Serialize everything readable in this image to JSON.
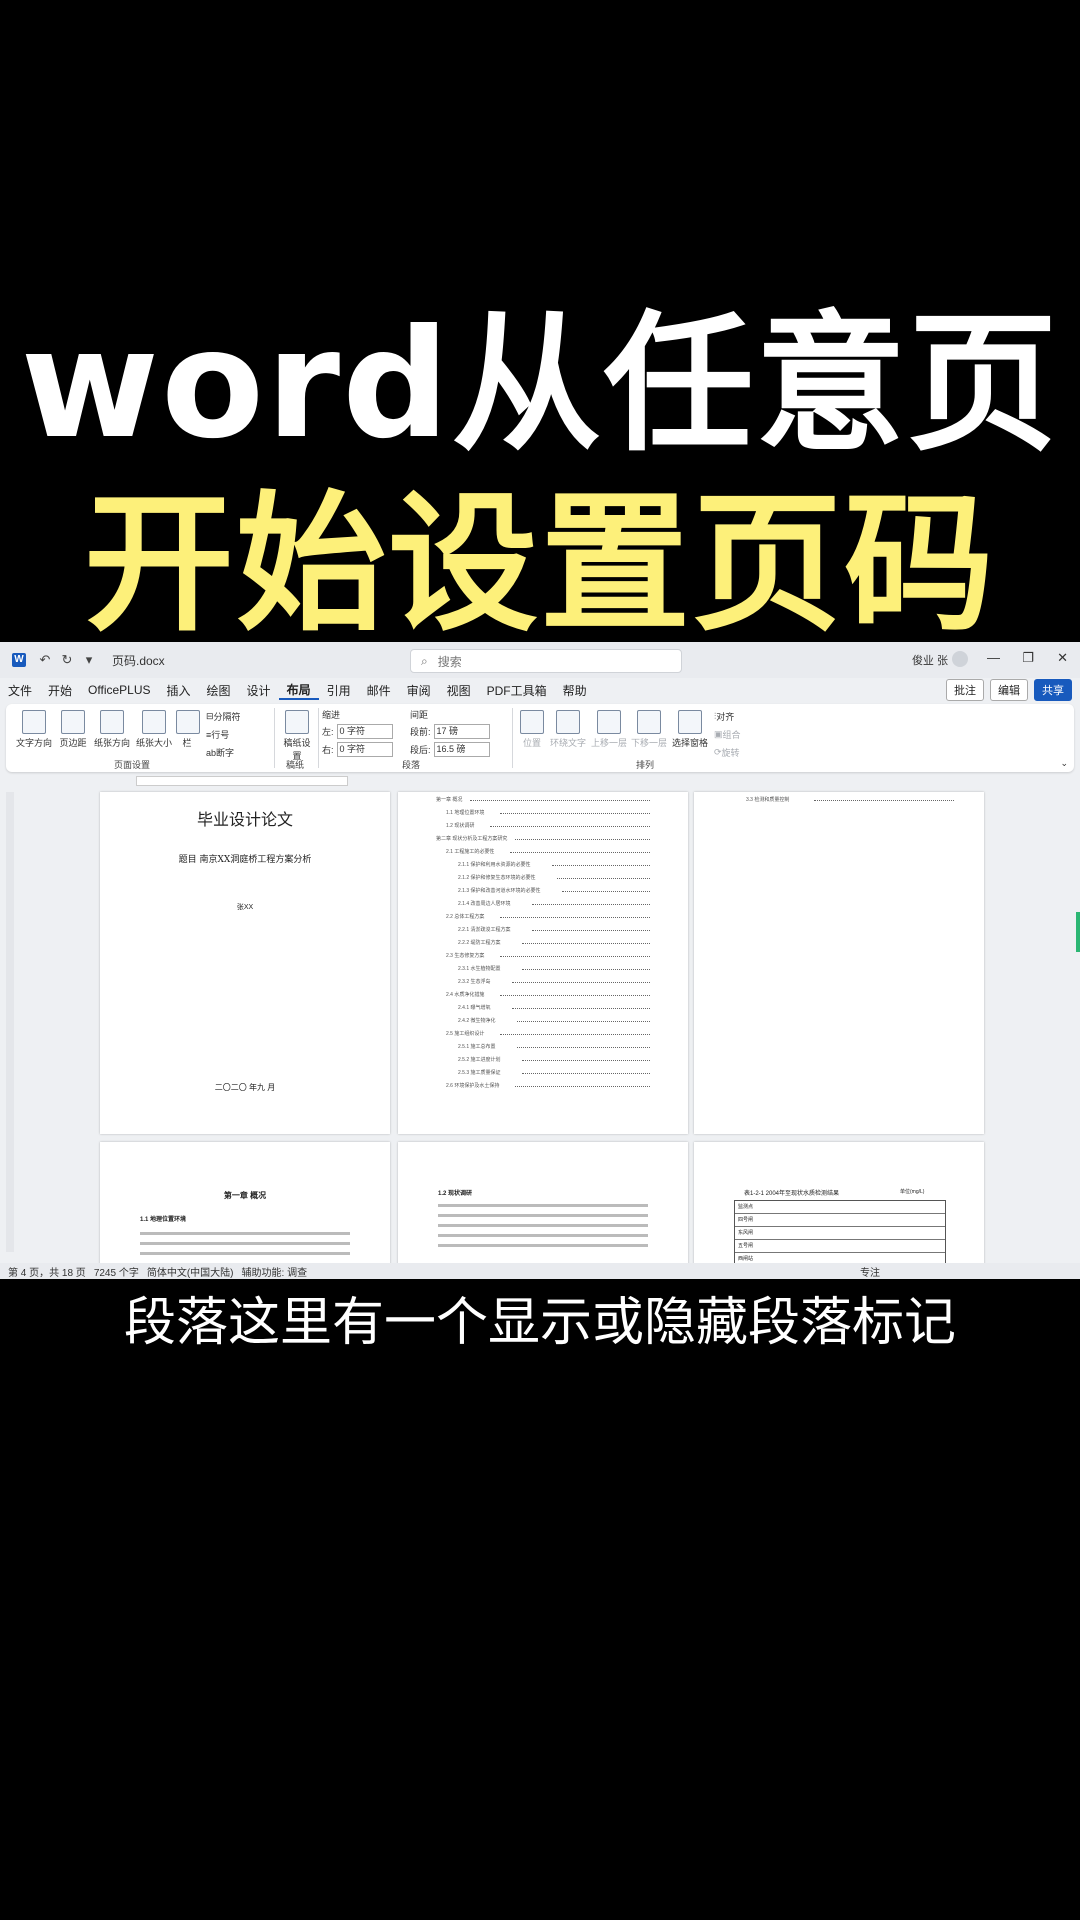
{
  "headline": {
    "line1": "word从任意页",
    "line2": "开始设置页码"
  },
  "caption": "段落这里有一个显示或隐藏段落标记",
  "titlebar": {
    "doc_name": "页码.docx",
    "search_placeholder": "搜索",
    "user_name": "俊业 张",
    "search_icon": "search-icon"
  },
  "menu": {
    "items": [
      "文件",
      "开始",
      "OfficePLUS",
      "插入",
      "绘图",
      "设计",
      "布局",
      "引用",
      "邮件",
      "审阅",
      "视图",
      "PDF工具箱",
      "帮助"
    ],
    "active": "布局",
    "comment_label": "批注",
    "edit_label": "编辑",
    "share_label": "共享"
  },
  "ribbon": {
    "text_direction": "文字方向",
    "margins": "页边距",
    "orientation": "纸张方向",
    "size": "纸张大小",
    "columns": "栏",
    "breaks": "分隔符",
    "line_numbers": "行号",
    "hyphenation": "断字",
    "group_page_setup": "页面设置",
    "draft_settings": "稿纸设置",
    "group_draft": "稿纸",
    "indent_label": "缩进",
    "spacing_label": "间距",
    "indent_left_label": "左:",
    "indent_left_value": "0 字符",
    "indent_right_label": "右:",
    "indent_right_value": "0 字符",
    "spacing_before_label": "段前:",
    "spacing_before_value": "17 磅",
    "spacing_after_label": "段后:",
    "spacing_after_value": "16.5 磅",
    "group_paragraph": "段落",
    "position": "位置",
    "wrap_text": "环绕文字",
    "bring_forward": "上移一层",
    "send_backward": "下移一层",
    "selection_pane": "选择窗格",
    "align": "对齐",
    "group": "组合",
    "rotate": "旋转",
    "group_arrange": "排列"
  },
  "pages": {
    "thesis_title": "毕业设计论文",
    "thesis_subject": "题目 南京XX洞庭桥工程方案分析",
    "author": "张XX",
    "date": "二〇二〇 年九 月",
    "toc_top_right": "3.3 检测和质量控制",
    "toc_entries": [
      "第一章 概况",
      "1.1 地理位置环境",
      "1.2 现状调研",
      "第二章 现状分析及工程方案研究",
      "2.1 工程施工的必要性",
      "2.1.1 保护和利用水资源的必要性",
      "2.1.2 保护和修复生态环境的必要性",
      "2.1.3 保护和改善河道水环境的必要性",
      "2.1.4 改善周边人居环境",
      "2.2 总体工程方案",
      "2.2.1 清淤疏浚工程方案",
      "2.2.2 堤防工程方案",
      "2.3 生态修复方案",
      "2.3.1 水生植物配置",
      "2.3.2 生态浮岛",
      "2.4 水质净化措施",
      "2.4.1 曝气增氧",
      "2.4.2 微生物净化",
      "2.5 施工组织设计",
      "2.5.1 施工总布置",
      "2.5.2 施工进度计划",
      "2.5.3 施工质量保证",
      "2.6 环境保护及水土保持"
    ],
    "chapter1_title": "第一章 概况",
    "section_11": "1.1 地理位置环境",
    "section_12": "1.2 现状调研",
    "table_caption": "表1-2-1 2004年至现状水质检测结果",
    "table_unit": "单位(mg/L)",
    "table_rows": [
      "监测点",
      "四号闸",
      "东风闸",
      "五号闸",
      "西闸站"
    ]
  },
  "status": {
    "page": "第 4 页，共 18 页",
    "words": "7245 个字",
    "language": "简体中文(中国大陆)",
    "accessibility": "辅助功能: 调查",
    "focus": "专注"
  }
}
